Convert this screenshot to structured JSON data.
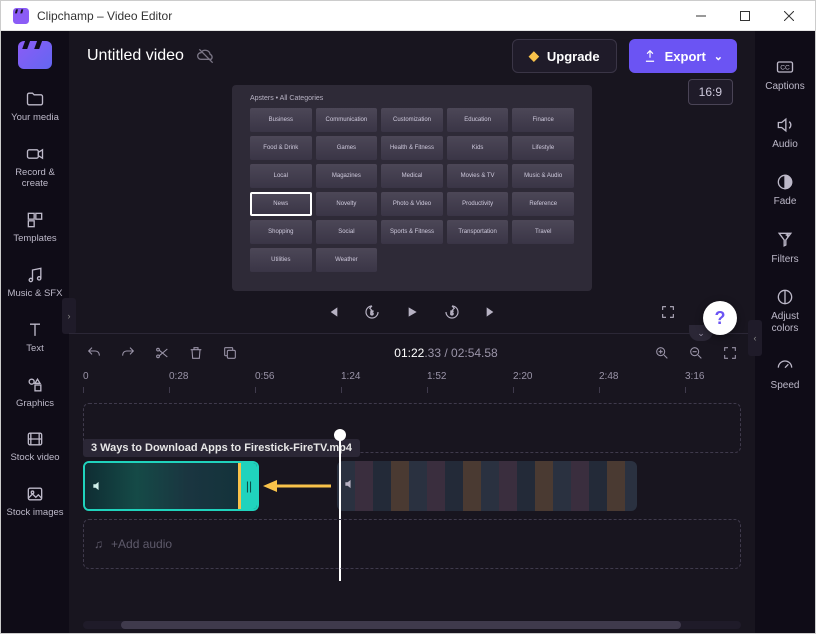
{
  "titlebar": {
    "title": "Clipchamp – Video Editor"
  },
  "header": {
    "project_title": "Untitled video",
    "upgrade_label": "Upgrade",
    "export_label": "Export",
    "aspect_label": "16:9"
  },
  "left_sidebar": {
    "items": [
      {
        "label": "Your media"
      },
      {
        "label": "Record & create"
      },
      {
        "label": "Templates"
      },
      {
        "label": "Music & SFX"
      },
      {
        "label": "Text"
      },
      {
        "label": "Graphics"
      },
      {
        "label": "Stock video"
      },
      {
        "label": "Stock images"
      }
    ]
  },
  "right_sidebar": {
    "items": [
      {
        "label": "Captions"
      },
      {
        "label": "Audio"
      },
      {
        "label": "Fade"
      },
      {
        "label": "Filters"
      },
      {
        "label": "Adjust colors"
      },
      {
        "label": "Speed"
      }
    ]
  },
  "preview": {
    "header_text": "Apsters • All Categories",
    "categories": [
      "Business",
      "Communication",
      "Customization",
      "Education",
      "Finance",
      "Food & Drink",
      "Games",
      "Health & Fitness",
      "Kids",
      "Lifestyle",
      "Local",
      "Magazines",
      "Medical",
      "Movies & TV",
      "Music & Audio",
      "News",
      "Novelty",
      "Photo & Video",
      "Productivity",
      "Reference",
      "Shopping",
      "Social",
      "Sports & Fitness",
      "Transportation",
      "Travel",
      "Utilities",
      "Weather"
    ],
    "selected_index": 15
  },
  "timecode": {
    "current": "01:22",
    "current_ms": ".33",
    "sep": " / ",
    "duration": "02:54",
    "duration_ms": ".58"
  },
  "ruler": {
    "ticks": [
      "0",
      "0:28",
      "0:56",
      "1:24",
      "1:52",
      "2:20",
      "2:48",
      "3:16"
    ]
  },
  "timeline": {
    "clip_title": "3 Ways to Download Apps to Firestick-FireTV.mp4",
    "add_audio_label": "Add audio"
  }
}
